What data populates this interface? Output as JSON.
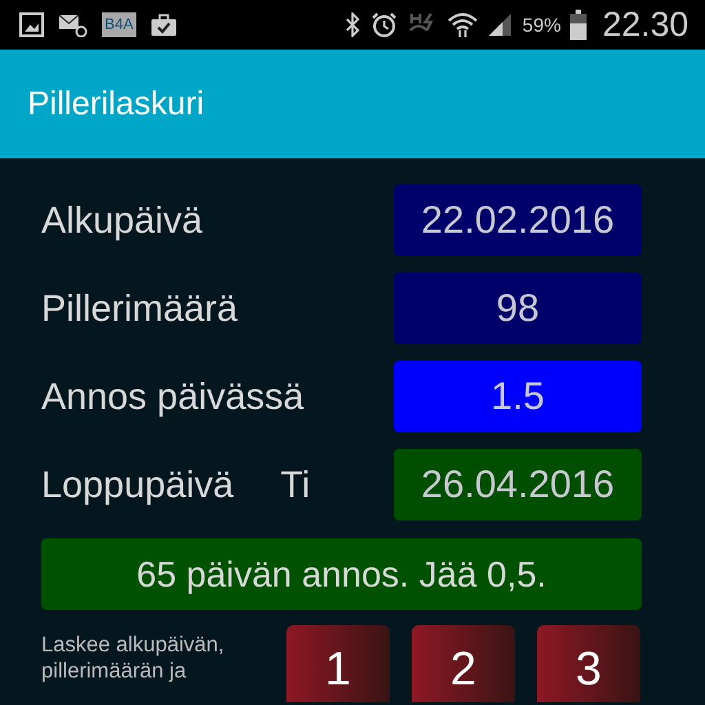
{
  "status_bar": {
    "battery": "59%",
    "time": "22.30",
    "notification_badge": "B4A"
  },
  "app_bar": {
    "title": "Pillerilaskuri"
  },
  "fields": [
    {
      "label": "Alkupäivä",
      "value": "22.02.2016",
      "color": "#00006b"
    },
    {
      "label": "Pillerimäärä",
      "value": "98",
      "color": "#00006b"
    },
    {
      "label": "Annos päivässä",
      "value": "1.5",
      "color": "#0000ff"
    },
    {
      "label": "Loppupäivä",
      "weekday": "Ti",
      "value": "26.04.2016",
      "color": "#004f00"
    }
  ],
  "result": {
    "text": "65 päivän annos. Jää 0,5.",
    "color": "#005200"
  },
  "note": "Laskee alkupäivän, pillerimäärän ja",
  "buttons": [
    "1",
    "2",
    "3"
  ]
}
